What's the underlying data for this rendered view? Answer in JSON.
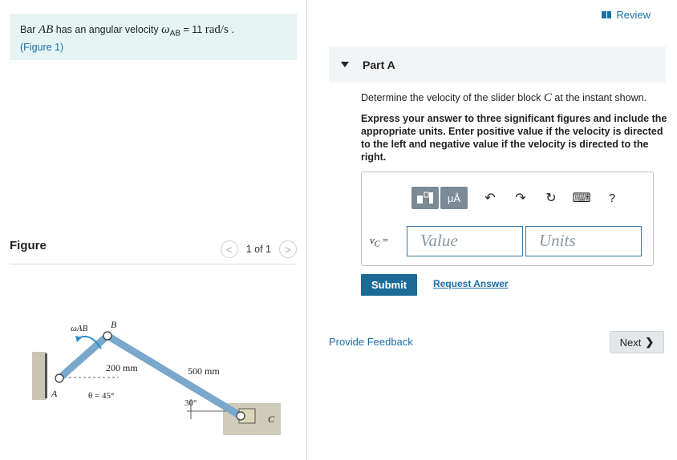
{
  "problem": {
    "text_before": "Bar ",
    "bar_var": "AB",
    "text_mid": " has an angular velocity ",
    "omega_symbol": "ω",
    "omega_sub": "AB",
    "equals": " = 11 ",
    "unit": "rad/s",
    "period": " .",
    "figure_link": "(Figure 1)"
  },
  "figure": {
    "title": "Figure",
    "pager_prev": "<",
    "pager_count": "1 of 1",
    "pager_next": ">",
    "labels": {
      "omega": "ωAB",
      "b": "B",
      "a": "A",
      "c": "C",
      "len_ab": "200 mm",
      "len_bc": "500 mm",
      "theta": "θ = 45°",
      "angle_c": "30°"
    }
  },
  "review": "Review",
  "part": {
    "title": "Part A"
  },
  "question": {
    "text_before": "Determine the velocity of the slider block ",
    "var": "C",
    "text_after": " at the instant shown."
  },
  "instructions": "Express your answer to three significant figures and include the appropriate units. Enter positive value if the velocity is directed to the left and negative value if the velocity is directed to the right.",
  "toolbar": {
    "templates_icon": "templates-icon",
    "units_label": "μÅ",
    "undo": "↶",
    "redo": "↷",
    "reset": "↻",
    "keyboard": "⌨",
    "help": "?"
  },
  "answer": {
    "label_var": "v",
    "label_sub": "C",
    "label_eq": " =",
    "value_placeholder": "Value",
    "units_placeholder": "Units"
  },
  "buttons": {
    "submit": "Submit",
    "request": "Request Answer",
    "feedback": "Provide Feedback",
    "next": "Next",
    "next_chevron": "❯"
  },
  "colors": {
    "accent": "#1a6ea8",
    "submit_bg": "#1d6a96",
    "problem_bg": "#e6f4f4",
    "linkage": "#6f9fc4"
  }
}
